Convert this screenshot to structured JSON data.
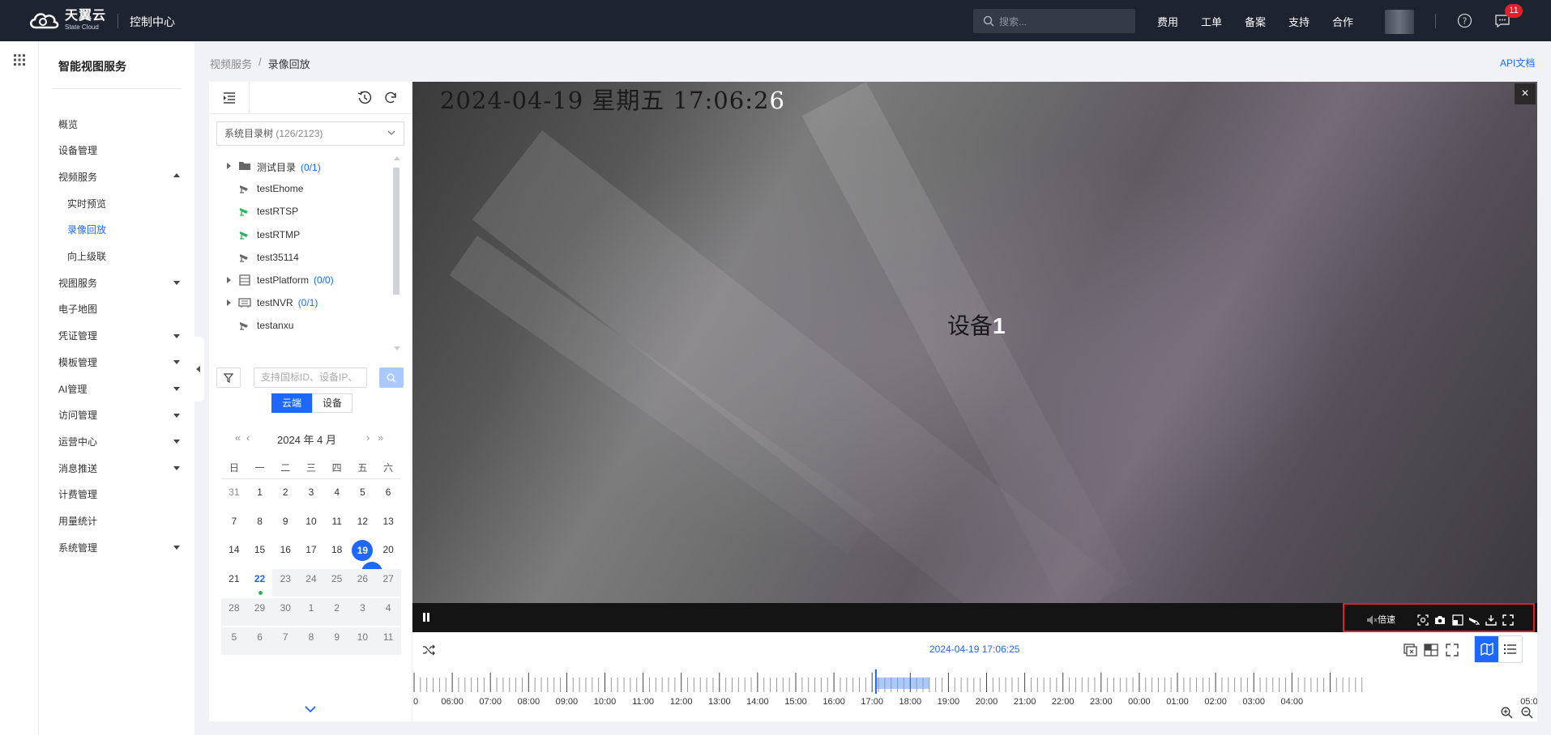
{
  "header": {
    "brand": "天翼云",
    "brand_sub": "State Cloud",
    "console": "控制中心",
    "search_placeholder": "搜索...",
    "nav": [
      "费用",
      "工单",
      "备案",
      "支持",
      "合作"
    ],
    "notification_count": "11"
  },
  "sidebar": {
    "title": "智能视图服务",
    "items": [
      {
        "label": "概览",
        "type": "item"
      },
      {
        "label": "设备管理",
        "type": "item"
      },
      {
        "label": "视频服务",
        "type": "group-open"
      },
      {
        "label": "实时预览",
        "type": "sub"
      },
      {
        "label": "录像回放",
        "type": "sub-active"
      },
      {
        "label": "向上级联",
        "type": "sub"
      },
      {
        "label": "视图服务",
        "type": "group"
      },
      {
        "label": "电子地图",
        "type": "item"
      },
      {
        "label": "凭证管理",
        "type": "group"
      },
      {
        "label": "模板管理",
        "type": "group"
      },
      {
        "label": "AI管理",
        "type": "group"
      },
      {
        "label": "访问管理",
        "type": "group"
      },
      {
        "label": "运营中心",
        "type": "group"
      },
      {
        "label": "消息推送",
        "type": "group"
      },
      {
        "label": "计费管理",
        "type": "item"
      },
      {
        "label": "用量统计",
        "type": "item"
      },
      {
        "label": "系统管理",
        "type": "group"
      }
    ]
  },
  "breadcrumb": {
    "parent": "视频服务",
    "separator": "/",
    "current": "录像回放"
  },
  "api_doc": "API文档",
  "tree": {
    "select_label": "系统目录树",
    "select_count": "(126/2123)",
    "rows": [
      {
        "label": "测试目录",
        "count": "(0/1)",
        "icon": "folder",
        "expandable": true
      },
      {
        "label": "testEhome",
        "count": "",
        "icon": "camera-offline",
        "expandable": false
      },
      {
        "label": "testRTSP",
        "count": "",
        "icon": "camera-online",
        "expandable": false
      },
      {
        "label": "testRTMP",
        "count": "",
        "icon": "camera-online",
        "expandable": false
      },
      {
        "label": "test35114",
        "count": "",
        "icon": "camera-offline",
        "expandable": false
      },
      {
        "label": "testPlatform",
        "count": "(0/0)",
        "icon": "platform",
        "expandable": true
      },
      {
        "label": "testNVR",
        "count": "(0/1)",
        "icon": "nvr",
        "expandable": true
      },
      {
        "label": "testanxu",
        "count": "",
        "icon": "camera-offline",
        "expandable": false
      }
    ]
  },
  "device_search_placeholder": "支持国标ID、设备IP、",
  "source_tabs": {
    "cloud": "云端",
    "device": "设备"
  },
  "calendar": {
    "title": "2024 年  4 月",
    "weekdays": [
      "日",
      "一",
      "二",
      "三",
      "四",
      "五",
      "六"
    ],
    "weeks": [
      [
        "31",
        "1",
        "2",
        "3",
        "4",
        "5",
        "6"
      ],
      [
        "7",
        "8",
        "9",
        "10",
        "11",
        "12",
        "13"
      ],
      [
        "14",
        "15",
        "16",
        "17",
        "18",
        "19",
        "20"
      ],
      [
        "21",
        "22",
        "23",
        "24",
        "25",
        "26",
        "27"
      ],
      [
        "28",
        "29",
        "30",
        "1",
        "2",
        "3",
        "4"
      ],
      [
        "5",
        "6",
        "7",
        "8",
        "9",
        "10",
        "11"
      ]
    ],
    "selected": "19",
    "today": "22",
    "recorded_days": [
      "19",
      "22"
    ]
  },
  "player": {
    "osd_time_main": "2024-04-19 星期五 17:06:2",
    "osd_time_last": "6",
    "osd_device_main": "设备",
    "osd_device_last": "1",
    "close": "×",
    "speed_label": "倍速"
  },
  "timeline": {
    "current_time": "2024-04-19 17:06:25",
    "labels": [
      "0",
      "06:00",
      "07:00",
      "08:00",
      "09:00",
      "10:00",
      "11:00",
      "12:00",
      "13:00",
      "14:00",
      "15:00",
      "16:00",
      "17:00",
      "18:00",
      "19:00",
      "20:00",
      "21:00",
      "22:00",
      "23:00",
      "00:00",
      "01:00",
      "02:00",
      "03:00",
      "04:00",
      "05:0"
    ],
    "recorded_segment": {
      "from": "17:06",
      "to": "18:30"
    },
    "accent": "#1e67ff"
  }
}
